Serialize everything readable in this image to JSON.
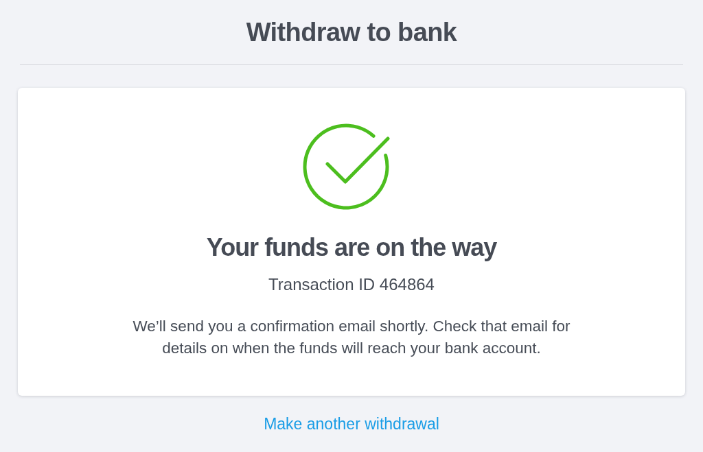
{
  "page_title": "Withdraw to bank",
  "confirmation": {
    "heading": "Your funds are on the way",
    "transaction_id": "Transaction ID 464864",
    "message": "We’ll send you a confirmation email shortly. Check that email for details on when the funds will reach your bank account."
  },
  "link": "Make another withdrawal"
}
